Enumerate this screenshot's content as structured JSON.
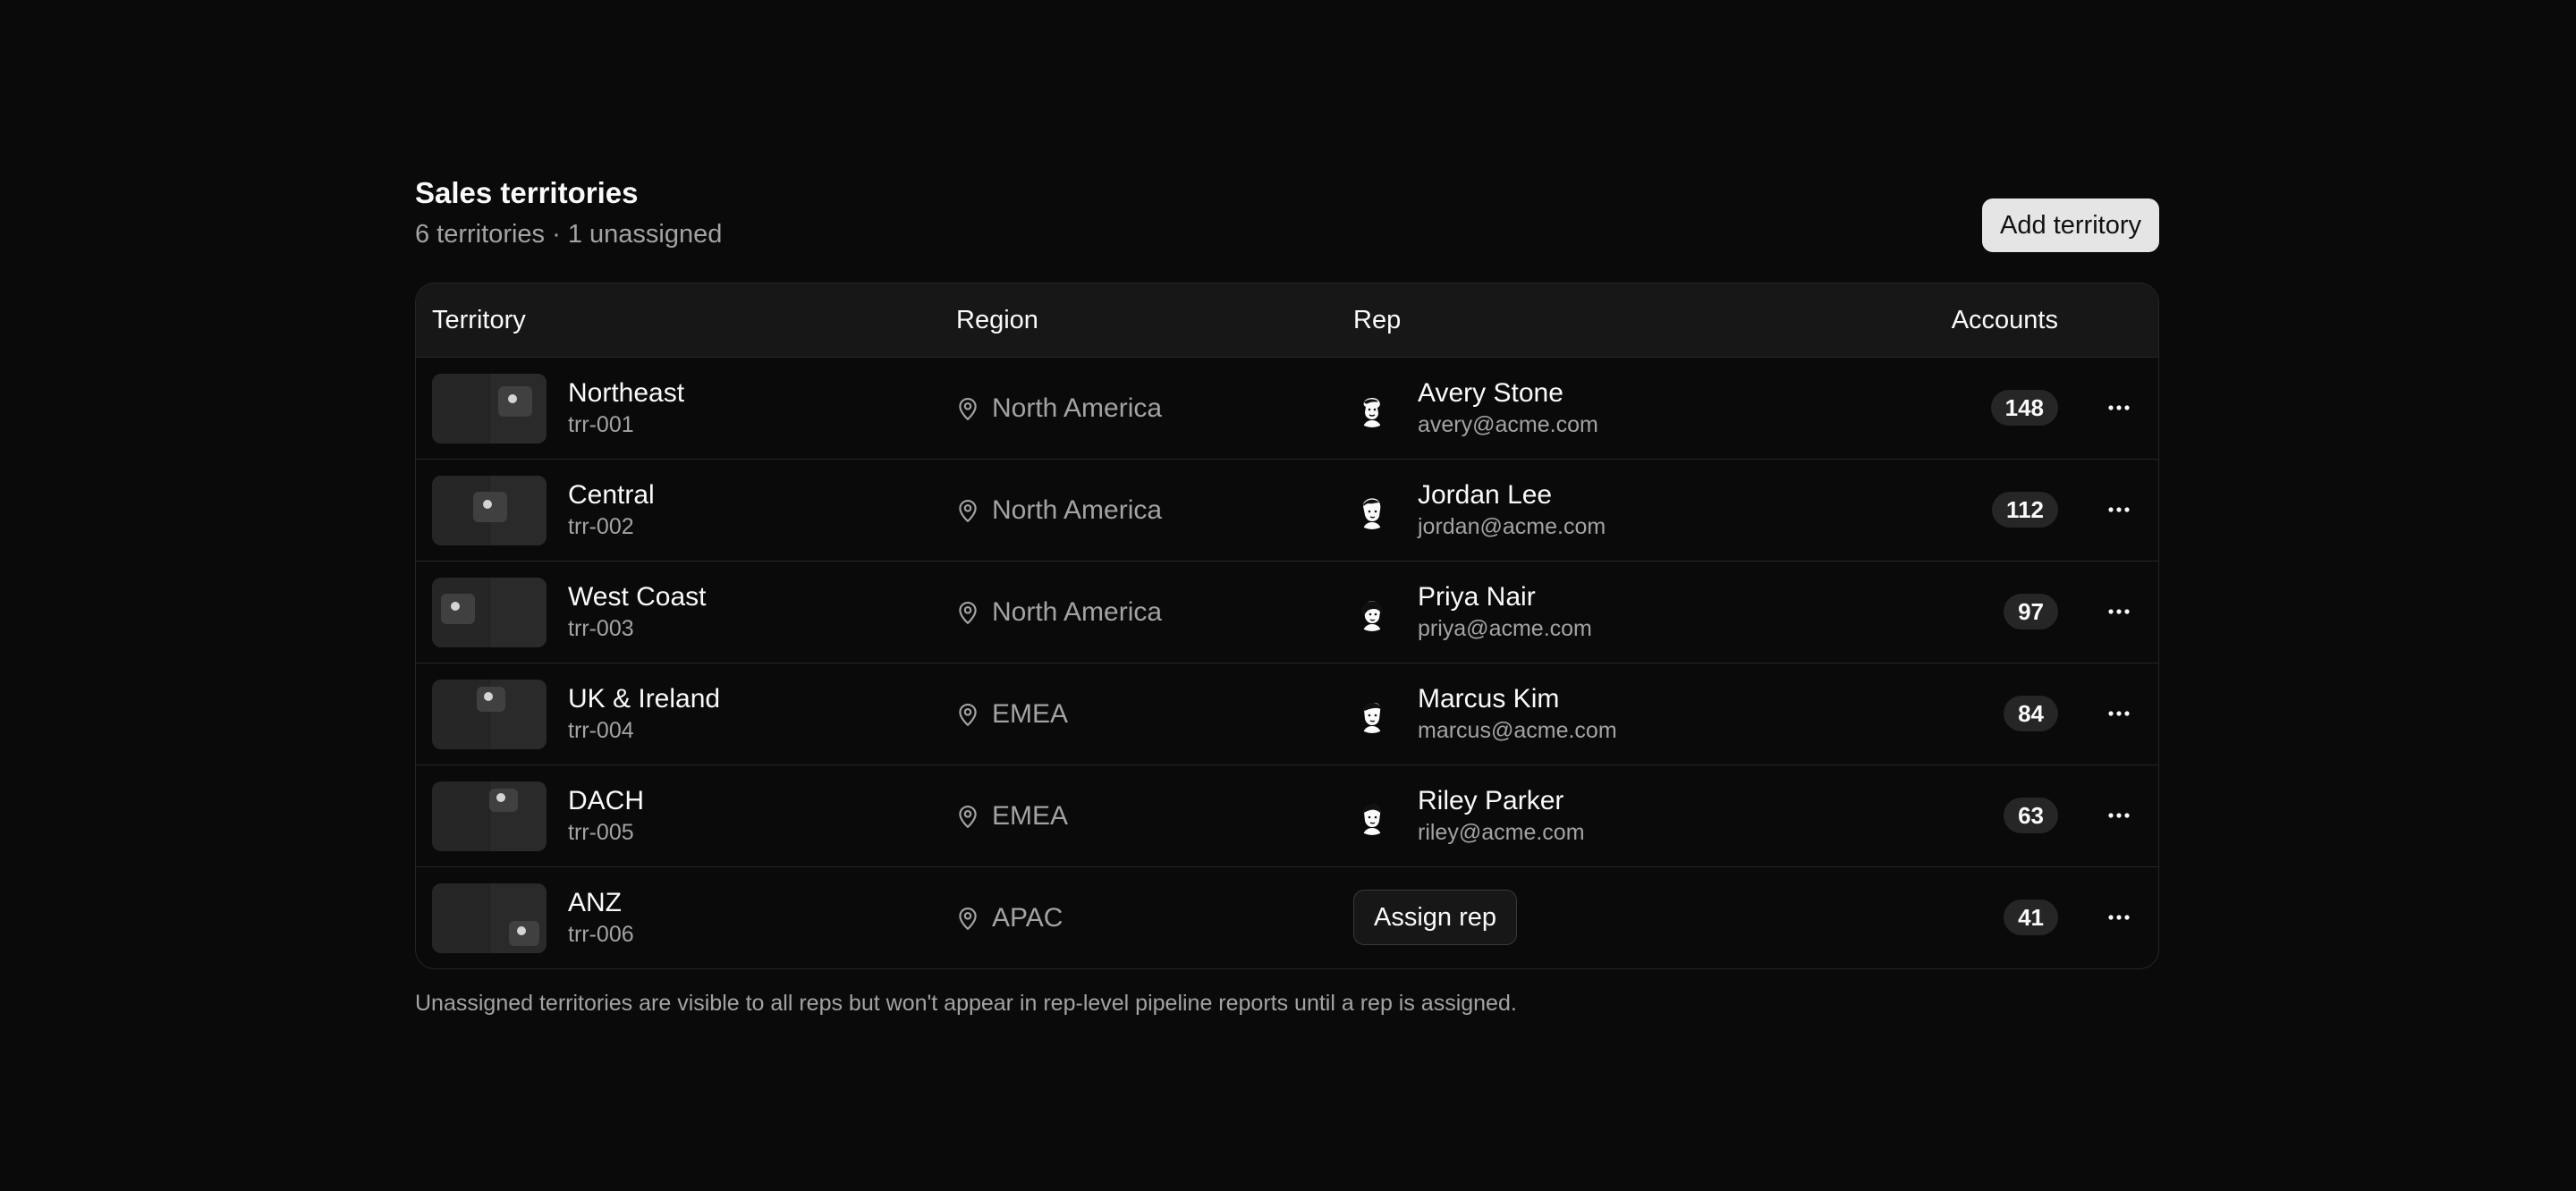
{
  "header": {
    "title": "Sales territories",
    "subtitle": "6 territories · 1 unassigned",
    "add_button_label": "Add territory"
  },
  "table": {
    "columns": {
      "territory": "Territory",
      "region": "Region",
      "rep": "Rep",
      "accounts": "Accounts"
    },
    "rows": [
      {
        "name": "Northeast",
        "code": "trr-001",
        "region": "North America",
        "rep": {
          "name": "Avery Stone",
          "email": "avery@acme.com"
        },
        "accounts": "148"
      },
      {
        "name": "Central",
        "code": "trr-002",
        "region": "North America",
        "rep": {
          "name": "Jordan Lee",
          "email": "jordan@acme.com"
        },
        "accounts": "112"
      },
      {
        "name": "West Coast",
        "code": "trr-003",
        "region": "North America",
        "rep": {
          "name": "Priya Nair",
          "email": "priya@acme.com"
        },
        "accounts": "97"
      },
      {
        "name": "UK & Ireland",
        "code": "trr-004",
        "region": "EMEA",
        "rep": {
          "name": "Marcus Kim",
          "email": "marcus@acme.com"
        },
        "accounts": "84"
      },
      {
        "name": "DACH",
        "code": "trr-005",
        "region": "EMEA",
        "rep": {
          "name": "Riley Parker",
          "email": "riley@acme.com"
        },
        "accounts": "63"
      },
      {
        "name": "ANZ",
        "code": "trr-006",
        "region": "APAC",
        "assign_label": "Assign rep",
        "accounts": "41"
      }
    ]
  },
  "footnote": "Unassigned territories are visible to all reps but won't appear in rep-level pipeline reports until a rep is assigned.",
  "icons": {
    "region": "map-pin-icon",
    "actions": "more-horizontal-icon",
    "thumbnail": "territory-map-thumbnail",
    "avatar": "avatar-illustration"
  },
  "colors": {
    "background": "#0a0a0a",
    "surface": "#171717",
    "border": "#262626",
    "text": "#fafafa",
    "muted": "#a3a3a3",
    "primary_button": "#e5e5e5"
  }
}
